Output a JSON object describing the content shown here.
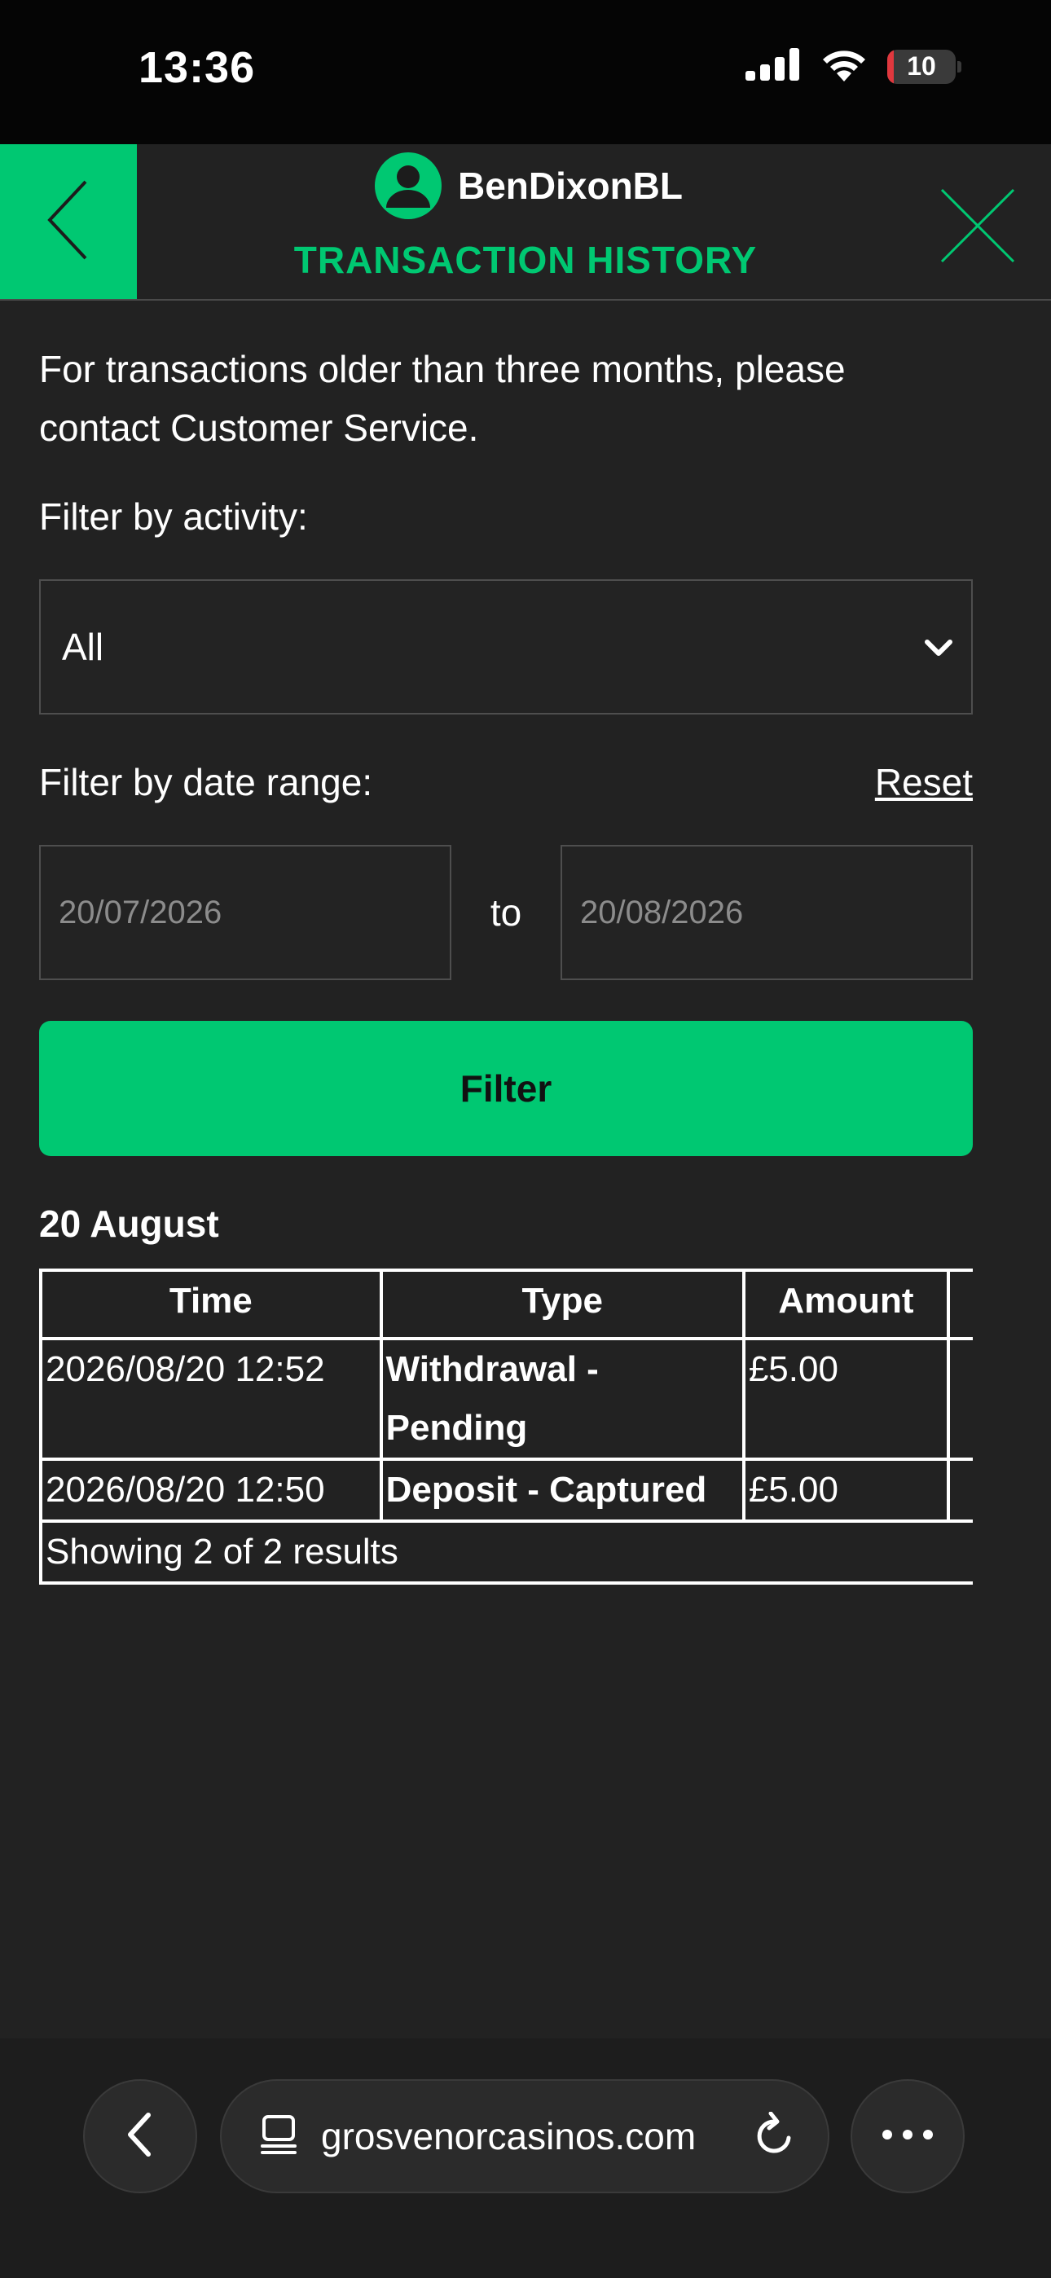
{
  "status_bar": {
    "time": "13:36",
    "battery_percent": "10",
    "battery_level": 0.1,
    "battery_color": "#e0383e"
  },
  "header": {
    "username": "BenDixonBL",
    "title": "TRANSACTION HISTORY",
    "back_icon": "chevron-left-icon",
    "close_icon": "close-icon",
    "avatar_icon": "user-avatar-icon",
    "accent_color": "#00c872"
  },
  "content": {
    "notice": "For transactions older than three months, please contact Customer Service.",
    "activity_label": "Filter by activity:",
    "activity_selected": "All",
    "date_range_label": "Filter by date range:",
    "reset_label": "Reset",
    "date_from_placeholder": "20/07/2026",
    "date_to_label": "to",
    "date_to_placeholder": "20/08/2026",
    "filter_button": "Filter",
    "section_date": "20 August"
  },
  "table": {
    "headers": [
      "Time",
      "Type",
      "Amount"
    ],
    "rows": [
      {
        "time": "2026/08/20 12:52",
        "type": "Withdrawal - Pending",
        "amount": "£5.00"
      },
      {
        "time": "2026/08/20 12:50",
        "type": "Deposit - Captured",
        "amount": "£5.00"
      }
    ],
    "results_text": "Showing 2 of 2 results"
  },
  "browser_bar": {
    "url": "grosvenorcasinos.com",
    "back_icon": "chevron-left-icon",
    "tabs_icon": "page-menu-icon",
    "reload_icon": "reload-icon",
    "more_icon": "more-dots-icon"
  }
}
